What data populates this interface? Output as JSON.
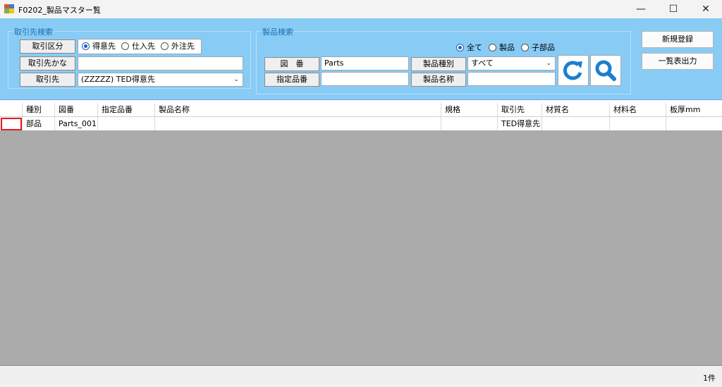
{
  "window": {
    "title": "F0202_製品マスター覧",
    "minimize": "—",
    "maximize": "☐",
    "close": "✕"
  },
  "customer_search": {
    "title": "取引先検索",
    "type_label": "取引区分",
    "type_options": [
      {
        "label": "得意先",
        "selected": true
      },
      {
        "label": "仕入先",
        "selected": false
      },
      {
        "label": "外注先",
        "selected": false
      }
    ],
    "kana_label": "取引先かな",
    "kana_value": "",
    "partner_label": "取引先",
    "partner_value": "(ZZZZZ) TED得意先"
  },
  "product_search": {
    "title": "製品検索",
    "scope_options": [
      {
        "label": "全て",
        "selected": true
      },
      {
        "label": "製品",
        "selected": false
      },
      {
        "label": "子部品",
        "selected": false
      }
    ],
    "drawing_no_label": "図　番",
    "drawing_no_value": "Parts",
    "designated_no_label": "指定品番",
    "designated_no_value": "",
    "product_type_label": "製品種別",
    "product_type_value": "すべて",
    "product_name_label": "製品名称",
    "product_name_value": ""
  },
  "actions": {
    "new_label": "新規登録",
    "export_label": "一覧表出力",
    "refresh_icon": "refresh-icon",
    "search_icon": "search-icon"
  },
  "grid": {
    "columns": [
      "",
      "種別",
      "図番",
      "指定品番",
      "製品名称",
      "規格",
      "取引先",
      "材質名",
      "材料名",
      "板厚mm"
    ],
    "rows": [
      [
        "",
        "部品",
        "Parts_001",
        "",
        "",
        "",
        "TED得意先",
        "",
        "",
        ""
      ]
    ]
  },
  "status": {
    "count": "1件"
  },
  "colors": {
    "panel": "#88ccf6",
    "accent": "#1a7fd0",
    "selection": "#e01b24",
    "grid_background": "#ababab"
  }
}
